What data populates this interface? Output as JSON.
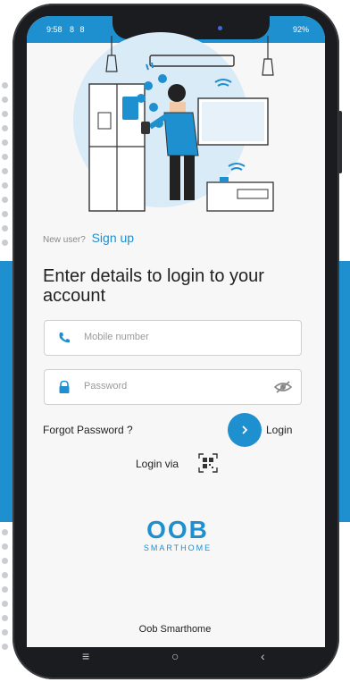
{
  "status_bar": {
    "time": "9:58",
    "left_icons": "8 8",
    "battery": "92%"
  },
  "signup": {
    "prompt": "New user?",
    "link": "Sign up"
  },
  "heading": "Enter details to login to your account",
  "mobile_field": {
    "placeholder": "Mobile number"
  },
  "password_field": {
    "placeholder": "Password"
  },
  "forgot_password": "Forgot Password ?",
  "login_label": "Login",
  "login_via": "Login via",
  "logo": {
    "brand": "OOB",
    "sub": "SMARTHOME"
  },
  "footer": {
    "app_name": "Oob Smarthome"
  },
  "colors": {
    "accent": "#1e8fcf",
    "text": "#222222",
    "placeholder": "#9a9a9a"
  },
  "icons": {
    "phone": "phone-icon",
    "lock": "lock-icon",
    "eye_off": "eye-off-icon",
    "chevron": "chevron-right-icon",
    "qr": "qr-code-icon"
  },
  "nav": {
    "menu": "≡",
    "home": "○",
    "back": "‹"
  }
}
